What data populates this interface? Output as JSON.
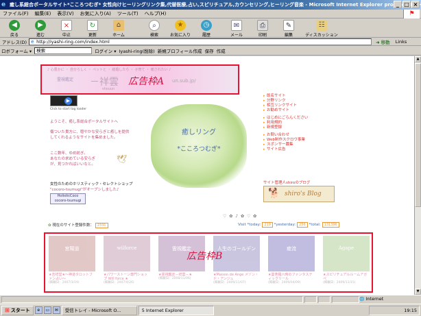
{
  "window": {
    "title": "癒し系総合ポータルサイト*こころつむぎ* 女性向けヒーリングリンク集,代替医療,占い,スピリチュアル,カウンセリング,ヒーリング音楽 - Microsoft Internet Explorer provided by Hewlett-",
    "min": "_",
    "max": "□",
    "close": "×"
  },
  "menubar": [
    "ファイル(F)",
    "編集(E)",
    "表示(V)",
    "お気に入り(A)",
    "ツール(T)",
    "ヘルプ(H)"
  ],
  "toolbar": {
    "back": "戻る",
    "forward": "進む",
    "stop": "中止",
    "refresh": "更新",
    "home": "ホーム",
    "search": "検索",
    "favorites": "お気に入り",
    "history": "履歴",
    "mail": "メール",
    "print": "印刷",
    "edit": "編集",
    "discuss": "ディスカッション"
  },
  "address": {
    "label": "アドレス(D)",
    "url": "http://iyashi-ring.com/index.html",
    "go": "移動",
    "links": "Links"
  },
  "linkbar": {
    "pb": "ロボフォーム ▾",
    "search": "検索",
    "login": "ログイン ▾",
    "site": "Iyashi-ring(削除)",
    "new_profile": "新規プロフィール作成",
    "save": "保存",
    "create": "作成"
  },
  "ad_a": {
    "small": "♪ 心豊かに ・ 自分らしく ・ ペットと ・ 結婚したら ・ 子育て ・ 癒されたい ♪",
    "brand": "霊視鑑定",
    "name": "－祥雲",
    "romaji": "shouun",
    "url": "un.sub.jp/",
    "tag": "広告枠A"
  },
  "player_caption": "Click to start tag loader",
  "intro": {
    "welcome": "ようこそ、癒し系総合ポータルサイトへ",
    "l1": "傷ついた貴方に、穏やかな安らぎと癒しを提供",
    "l2": "してくれるようなサイトを集めました。",
    "l3": "ここ数年、ゆめ紡ぎ。",
    "l4": "あなたの求めている安らぎ",
    "l5": "が、見つかればいいなと。"
  },
  "holistic": {
    "line1": "女性のためのホリスティック・セレクトショップ",
    "line2": "\"cocoro-tsumugi\"がオープンしました♪",
    "logo_top": "HolisticCoco",
    "logo_bottom": "cocoro-tsumugi"
  },
  "hero": {
    "title1": "癒しリング",
    "title2": "*こころつむぎ*"
  },
  "menu": [
    {
      "label": "既名サイト"
    },
    {
      "label": "分野リンク"
    },
    {
      "label": "相互リンクサイト"
    },
    {
      "label": "お勧めサイト"
    },
    {
      "gap": true
    },
    {
      "label": "はじめにごらんください"
    },
    {
      "label": "利用規約"
    },
    {
      "label": "新規登録"
    },
    {
      "gap": true
    },
    {
      "label": "お問い合わせ"
    },
    {
      "label": "Web制作スクロウ事業"
    },
    {
      "label": "スポンサー募集"
    },
    {
      "label": "サイト広告"
    }
  ],
  "blog": {
    "caption": "サイト管理人shiroのブログ",
    "banner": "shiro's Blog"
  },
  "counter": {
    "registered_label": "現在のサイト登録件数：",
    "registered": "2331",
    "visit_label": "Visit",
    "today_label": "*today:",
    "today": "219",
    "yesterday_label": "*yesterday:",
    "yesterday": "256",
    "total_label": "*total:",
    "total": "131396"
  },
  "ad_b": {
    "tag": "広告枠B",
    "items": [
      {
        "thumb": "宮陽道",
        "color": "#cc9a9a",
        "caption": "★吉祥堂★～神道タロットファン占い～",
        "date": "(掲載日：2007/3/19)"
      },
      {
        "thumb": "wilforce",
        "color": "#c8a4b8",
        "caption": "★パワーストーン専門ショップ Will force ★",
        "date": "(掲載日：2007/4/26)"
      },
      {
        "thumb": "霊視鑑定",
        "color": "#b290b8",
        "caption": "★霊視鑑定－祥雲－★",
        "date": "(掲載日：2008/11/06)"
      },
      {
        "thumb": "人生のゴールデン",
        "color": "#a098c8",
        "caption": "★Maison de Ange メゾン・ド・アンジュ",
        "date": "(掲載日：2009/11/07)"
      },
      {
        "thumb": "癒流",
        "color": "#9088c8",
        "caption": "★曼荼羅六時のファンタスティックリール",
        "date": "(掲載日：2009/04/09)"
      },
      {
        "thumb": "Agape",
        "color": "#b4d09a",
        "caption": "★スピリチュアルルームアガペ",
        "date": "(掲載日：2009/11/15)"
      }
    ]
  },
  "status": {
    "zone": "Internet"
  },
  "taskbar": {
    "start": "スタート",
    "tasks": [
      "受信トレイ - Microsoft O...",
      "5 Internet Explorer"
    ],
    "clock": "19:15"
  }
}
